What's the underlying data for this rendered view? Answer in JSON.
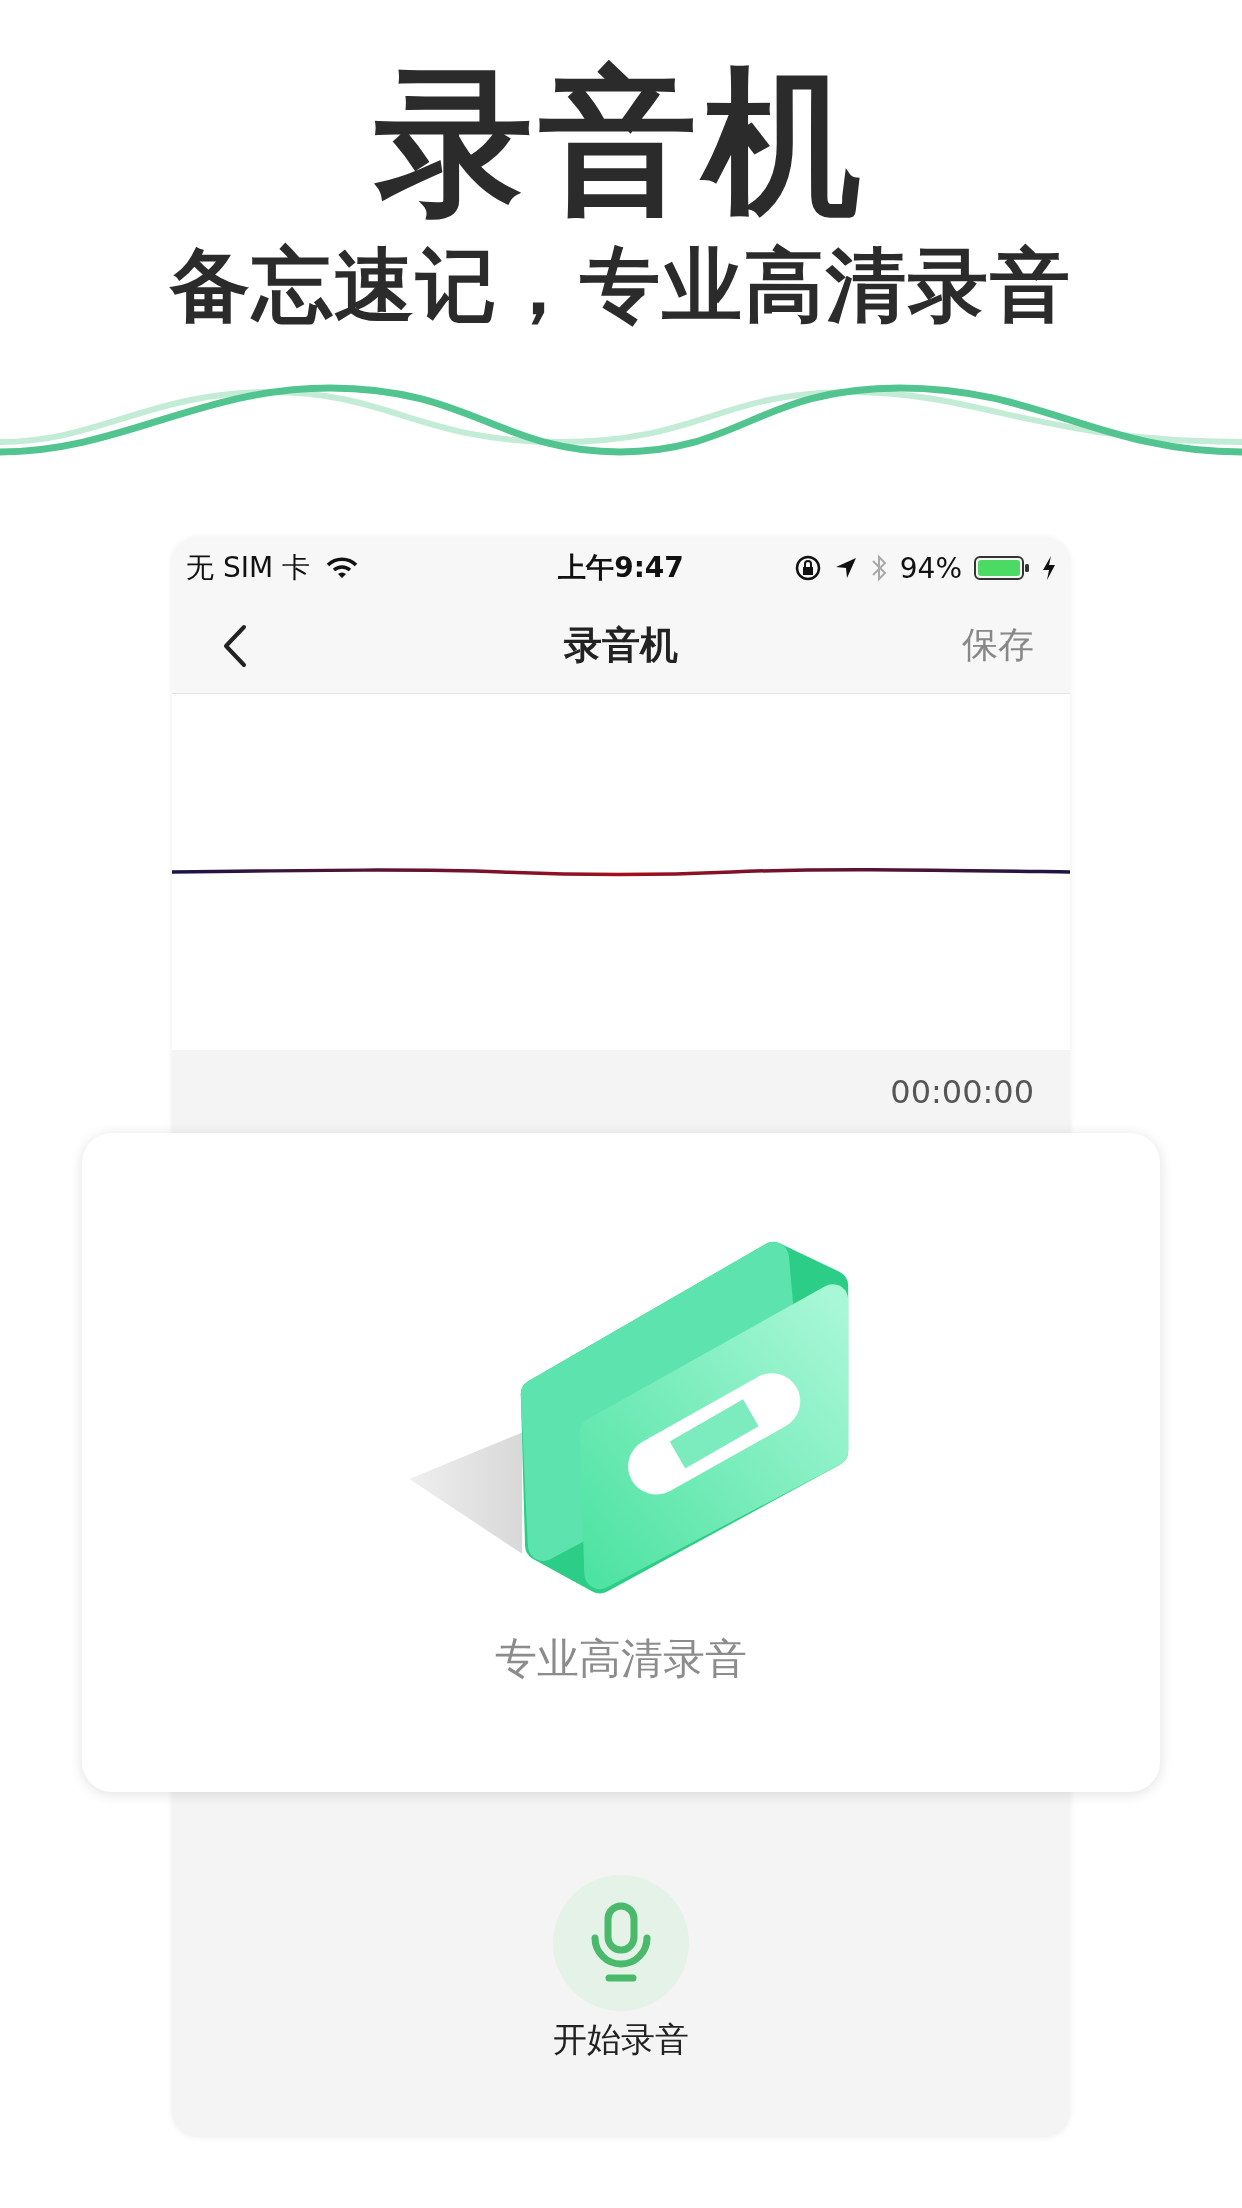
{
  "header": {
    "title": "录音机",
    "subtitle": "备忘速记，专业高清录音"
  },
  "status_bar": {
    "carrier": "无 SIM 卡",
    "time": "上午9:47",
    "battery": "94%"
  },
  "nav": {
    "title": "录音机",
    "action": "保存"
  },
  "timer": "00:00:00",
  "card": {
    "caption": "专业高清录音"
  },
  "record_button": {
    "label": "开始录音"
  }
}
